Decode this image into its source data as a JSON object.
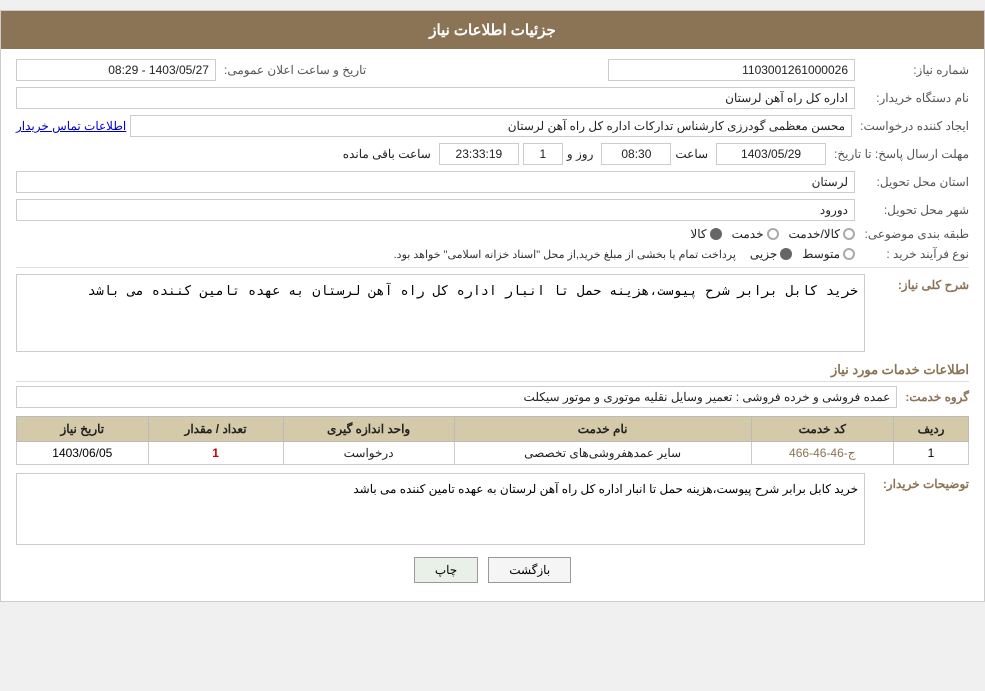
{
  "header": {
    "title": "جزئیات اطلاعات نیاز"
  },
  "fields": {
    "شماره_نیاز_label": "شماره نیاز:",
    "شماره_نیاز_value": "1103001261000026",
    "تاریخ_label": "تاریخ و ساعت اعلان عمومی:",
    "تاریخ_value": "1403/05/27 - 08:29",
    "نام_دستگاه_label": "نام دستگاه خریدار:",
    "نام_دستگاه_value": "اداره کل راه آهن لرستان",
    "ایجاد_label": "ایجاد کننده درخواست:",
    "ایجاد_value": "محسن معظمی گودرزی کارشناس تدارکات اداره کل راه آهن لرستان",
    "تماس_label": "اطلاعات تماس خریدار",
    "مهلت_label": "مهلت ارسال پاسخ: تا تاریخ:",
    "مهلت_date": "1403/05/29",
    "مهلت_ساعت_label": "ساعت",
    "مهلت_ساعت_value": "08:30",
    "مهلت_روز_label": "روز و",
    "مهلت_روز_value": "1",
    "مهلت_باقی_label": "ساعت باقی مانده",
    "مهلت_باقی_value": "23:33:19",
    "استان_label": "استان محل تحویل:",
    "استان_value": "لرستان",
    "شهر_label": "شهر محل تحویل:",
    "شهر_value": "دورود",
    "طبقه_label": "طبقه بندی موضوعی:",
    "طبقه_options": [
      "کالا",
      "خدمت",
      "کالا/خدمت"
    ],
    "طبقه_selected": "کالا",
    "نوع_label": "نوع فرآیند خرید :",
    "نوع_options": [
      "جزیی",
      "متوسط"
    ],
    "نوع_note": "پرداخت تمام یا بخشی از مبلغ خرید,از محل \"اسناد خزانه اسلامی\" خواهد بود.",
    "شرح_label": "شرح کلی نیاز:",
    "شرح_value": "خرید کابل برابر شرح پیوست،هزینه حمل تا انبار اداره کل راه آهن لرستان به عهده تامین کننده می باشد",
    "section_title": "اطلاعات خدمات مورد نیاز",
    "گروه_label": "گروه خدمت:",
    "گروه_value": "عمده فروشی و خرده فروشی : تعمیر وسایل نقلیه موتوری و موتور سیکلت"
  },
  "table": {
    "headers": [
      "ردیف",
      "کد خدمت",
      "نام خدمت",
      "واحد اندازه گیری",
      "تعداد / مقدار",
      "تاریخ نیاز"
    ],
    "rows": [
      {
        "ردیف": "1",
        "کد_خدمت": "ج-46-46-466",
        "نام_خدمت": "سایر عمدهفروشی‌های تخصصی",
        "واحد": "درخواست",
        "تعداد": "1",
        "تاریخ": "1403/06/05"
      }
    ]
  },
  "توضیحات_label": "توضیحات خریدار:",
  "توضیحات_value": "خرید کابل برابر شرح پیوست،هزینه حمل تا انبار اداره کل راه آهن لرستان به عهده تامین کننده می باشد",
  "buttons": {
    "print": "چاپ",
    "back": "بازگشت"
  }
}
